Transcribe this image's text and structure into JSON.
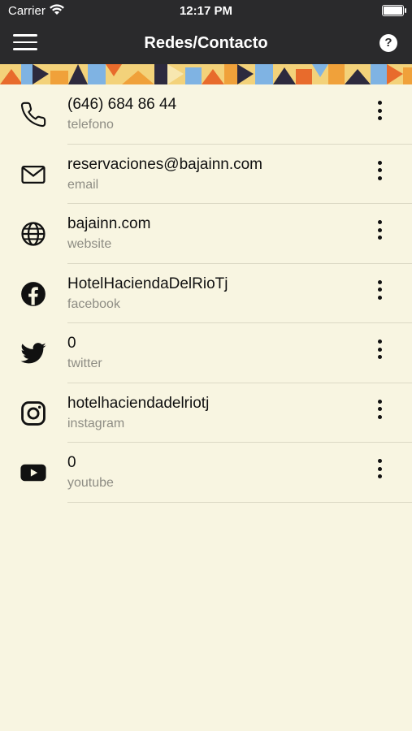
{
  "status_bar": {
    "carrier": "Carrier",
    "time": "12:17 PM"
  },
  "header": {
    "title": "Redes/Contacto",
    "menu_icon": "hamburger-icon",
    "help_icon": "help-icon",
    "help_glyph": "?"
  },
  "contacts": [
    {
      "value": "(646) 684 86 44",
      "label": "telefono",
      "icon": "phone-icon"
    },
    {
      "value": "reservaciones@bajainn.com",
      "label": "email",
      "icon": "email-icon"
    },
    {
      "value": "bajainn.com",
      "label": "website",
      "icon": "globe-icon"
    },
    {
      "value": "HotelHaciendaDelRioTj",
      "label": "facebook",
      "icon": "facebook-icon"
    },
    {
      "value": "0",
      "label": "twitter",
      "icon": "twitter-icon"
    },
    {
      "value": "hotelhaciendadelriotj",
      "label": "instagram",
      "icon": "instagram-icon"
    },
    {
      "value": "0",
      "label": "youtube",
      "icon": "youtube-icon"
    }
  ],
  "colors": {
    "background": "#f8f5e1",
    "header": "#2a2a2c"
  }
}
